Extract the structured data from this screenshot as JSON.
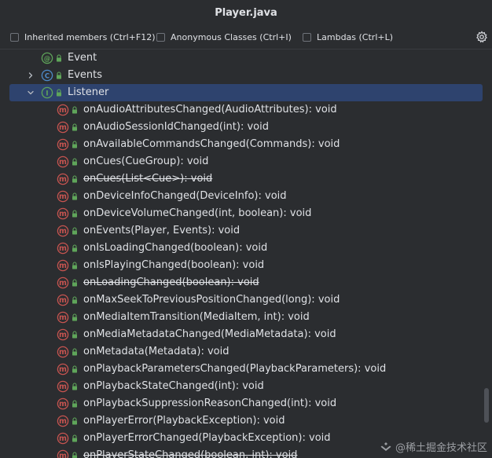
{
  "window": {
    "title": "Player.java"
  },
  "options": {
    "inherited_label": "Inherited members (Ctrl+F12)",
    "anonymous_label": "Anonymous Classes (Ctrl+I)",
    "lambdas_label": "Lambdas (Ctrl+L)",
    "settings_icon": "gear-icon"
  },
  "tree": {
    "items": [
      {
        "label": "Event",
        "kind": "annotation",
        "indent": 1,
        "chevron": "none",
        "deprecated": false,
        "selected": false
      },
      {
        "label": "Events",
        "kind": "class",
        "indent": 1,
        "chevron": "collapsed",
        "deprecated": false,
        "selected": false
      },
      {
        "label": "Listener",
        "kind": "interface",
        "indent": 1,
        "chevron": "expanded",
        "deprecated": false,
        "selected": true
      },
      {
        "label": "onAudioAttributesChanged(AudioAttributes): void",
        "kind": "method",
        "indent": 2,
        "chevron": "none",
        "deprecated": false,
        "selected": false
      },
      {
        "label": "onAudioSessionIdChanged(int): void",
        "kind": "method",
        "indent": 2,
        "chevron": "none",
        "deprecated": false,
        "selected": false
      },
      {
        "label": "onAvailableCommandsChanged(Commands): void",
        "kind": "method",
        "indent": 2,
        "chevron": "none",
        "deprecated": false,
        "selected": false
      },
      {
        "label": "onCues(CueGroup): void",
        "kind": "method",
        "indent": 2,
        "chevron": "none",
        "deprecated": false,
        "selected": false
      },
      {
        "label": "onCues(List<Cue>): void",
        "kind": "method",
        "indent": 2,
        "chevron": "none",
        "deprecated": true,
        "selected": false
      },
      {
        "label": "onDeviceInfoChanged(DeviceInfo): void",
        "kind": "method",
        "indent": 2,
        "chevron": "none",
        "deprecated": false,
        "selected": false
      },
      {
        "label": "onDeviceVolumeChanged(int, boolean): void",
        "kind": "method",
        "indent": 2,
        "chevron": "none",
        "deprecated": false,
        "selected": false
      },
      {
        "label": "onEvents(Player, Events): void",
        "kind": "method",
        "indent": 2,
        "chevron": "none",
        "deprecated": false,
        "selected": false
      },
      {
        "label": "onIsLoadingChanged(boolean): void",
        "kind": "method",
        "indent": 2,
        "chevron": "none",
        "deprecated": false,
        "selected": false
      },
      {
        "label": "onIsPlayingChanged(boolean): void",
        "kind": "method",
        "indent": 2,
        "chevron": "none",
        "deprecated": false,
        "selected": false
      },
      {
        "label": "onLoadingChanged(boolean): void",
        "kind": "method",
        "indent": 2,
        "chevron": "none",
        "deprecated": true,
        "selected": false
      },
      {
        "label": "onMaxSeekToPreviousPositionChanged(long): void",
        "kind": "method",
        "indent": 2,
        "chevron": "none",
        "deprecated": false,
        "selected": false
      },
      {
        "label": "onMediaItemTransition(MediaItem, int): void",
        "kind": "method",
        "indent": 2,
        "chevron": "none",
        "deprecated": false,
        "selected": false
      },
      {
        "label": "onMediaMetadataChanged(MediaMetadata): void",
        "kind": "method",
        "indent": 2,
        "chevron": "none",
        "deprecated": false,
        "selected": false
      },
      {
        "label": "onMetadata(Metadata): void",
        "kind": "method",
        "indent": 2,
        "chevron": "none",
        "deprecated": false,
        "selected": false
      },
      {
        "label": "onPlaybackParametersChanged(PlaybackParameters): void",
        "kind": "method",
        "indent": 2,
        "chevron": "none",
        "deprecated": false,
        "selected": false
      },
      {
        "label": "onPlaybackStateChanged(int): void",
        "kind": "method",
        "indent": 2,
        "chevron": "none",
        "deprecated": false,
        "selected": false
      },
      {
        "label": "onPlaybackSuppressionReasonChanged(int): void",
        "kind": "method",
        "indent": 2,
        "chevron": "none",
        "deprecated": false,
        "selected": false
      },
      {
        "label": "onPlayerError(PlaybackException): void",
        "kind": "method",
        "indent": 2,
        "chevron": "none",
        "deprecated": false,
        "selected": false
      },
      {
        "label": "onPlayerErrorChanged(PlaybackException): void",
        "kind": "method",
        "indent": 2,
        "chevron": "none",
        "deprecated": false,
        "selected": false
      },
      {
        "label": "onPlayerStateChanged(boolean, int): void",
        "kind": "method",
        "indent": 2,
        "chevron": "none",
        "deprecated": true,
        "selected": false
      }
    ]
  },
  "colors": {
    "background": "#2b2d30",
    "selection": "#2e436e",
    "method_icon": "#c75450",
    "class_icon": "#4d8ac9",
    "interface_icon": "#5fa55a",
    "annotation_icon": "#5fa55a",
    "lock_icon": "#5fa55a",
    "text": "#dfe1e5"
  },
  "watermark": {
    "text": "@稀土掘金技术社区"
  }
}
